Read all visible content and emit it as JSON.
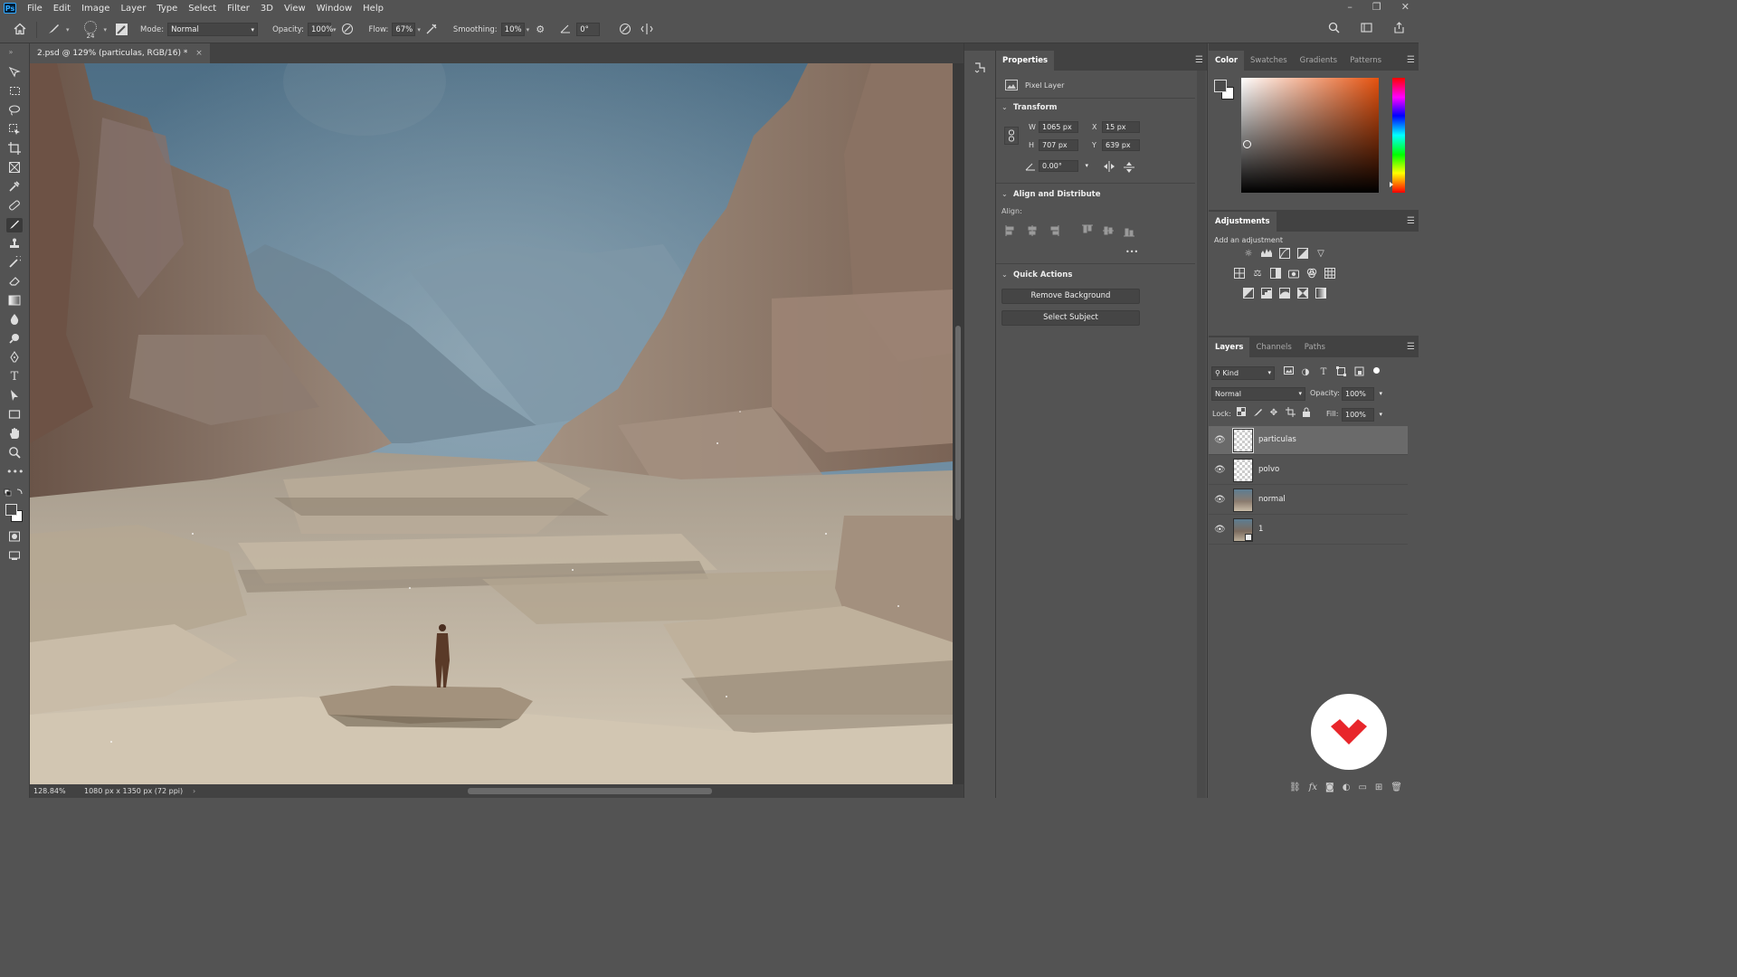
{
  "menubar": {
    "logo": "Ps",
    "items": [
      "File",
      "Edit",
      "Image",
      "Layer",
      "Type",
      "Select",
      "Filter",
      "3D",
      "View",
      "Window",
      "Help"
    ],
    "controls": [
      "–",
      "❐",
      "✕"
    ]
  },
  "options": {
    "brush_size": "24",
    "mode_label": "Mode:",
    "mode_value": "Normal",
    "opacity_label": "Opacity:",
    "opacity_value": "100%",
    "flow_label": "Flow:",
    "flow_value": "67%",
    "smoothing_label": "Smoothing:",
    "smoothing_value": "10%",
    "angle_value": "0°"
  },
  "document": {
    "tab_title": "2.psd @ 129% (particulas, RGB/16) *",
    "close": "×"
  },
  "status": {
    "zoom": "128.84%",
    "info": "1080 px x 1350 px (72 ppi)",
    "arrow": "›"
  },
  "properties": {
    "title": "Properties",
    "layer_type": "Pixel Layer",
    "transform": {
      "title": "Transform",
      "w_label": "W",
      "w": "1065 px",
      "h_label": "H",
      "h": "707 px",
      "x_label": "X",
      "x": "15 px",
      "y_label": "Y",
      "y": "639 px",
      "angle": "0.00°"
    },
    "align": {
      "title": "Align and Distribute",
      "label": "Align:",
      "more": "•••"
    },
    "quick_actions": {
      "title": "Quick Actions",
      "remove_bg": "Remove Background",
      "select_subject": "Select Subject"
    }
  },
  "color_panel": {
    "tabs": [
      "Color",
      "Swatches",
      "Gradients",
      "Patterns"
    ]
  },
  "adjustments": {
    "title": "Adjustments",
    "subtitle": "Add an adjustment"
  },
  "layers_panel": {
    "tabs": [
      "Layers",
      "Channels",
      "Paths"
    ],
    "filter_kind": "Kind",
    "blend_mode": "Normal",
    "opacity_label": "Opacity:",
    "opacity_value": "100%",
    "lock_label": "Lock:",
    "fill_label": "Fill:",
    "fill_value": "100%",
    "layers": [
      {
        "name": "particulas",
        "selected": true
      },
      {
        "name": "polvo",
        "selected": false
      },
      {
        "name": "normal",
        "selected": false
      },
      {
        "name": "1",
        "selected": false
      }
    ]
  },
  "colors": {
    "ui_bg": "#535353",
    "panel_dark": "#424242",
    "logo_red": "#e8262b"
  }
}
